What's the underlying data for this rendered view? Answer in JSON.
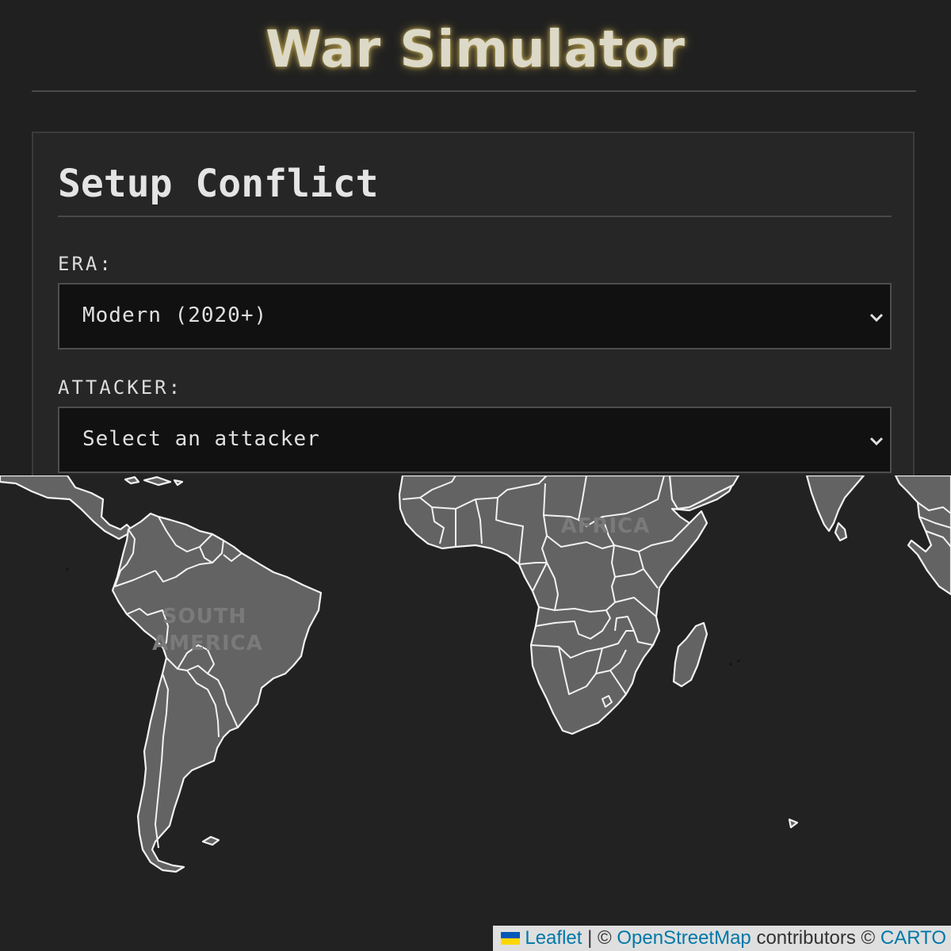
{
  "app": {
    "title": "War Simulator"
  },
  "setup": {
    "title": "Setup Conflict",
    "era": {
      "label": "ERA:",
      "value": "Modern (2020+)"
    },
    "attacker": {
      "label": "ATTACKER:",
      "value": "Select an attacker"
    }
  },
  "map": {
    "labels": {
      "south_america_line1": "SOUTH",
      "south_america_line2": "AMERICA",
      "africa": "AFRICA"
    },
    "attribution": {
      "leaflet": "Leaflet",
      "sep1": " | © ",
      "osm": "OpenStreetMap",
      "contributors": " contributors © ",
      "carto": "CARTO"
    }
  },
  "colors": {
    "accent_glow": "#e6c85a",
    "land_fill": "#636363",
    "water": "#222222",
    "link": "#0078a8",
    "flag_blue": "#0057b7",
    "flag_yellow": "#ffd700"
  }
}
